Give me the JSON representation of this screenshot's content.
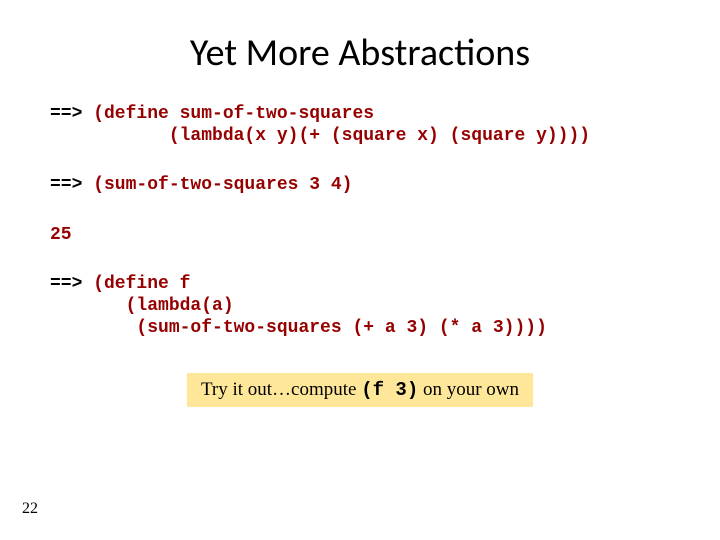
{
  "title": "Yet More Abstractions",
  "prompt": "==>",
  "code1a": " (define sum-of-two-squares",
  "code1b": "           (lambda(x y)(+ (square x) (square y))))",
  "code2": " (sum-of-two-squares 3 4)",
  "result": "25",
  "code3a": " (define f",
  "code3b": "       (lambda(a)",
  "code3c": "        (sum-of-two-squares (+ a 3) (* a 3))))",
  "callout_pre": "Try it out…compute ",
  "callout_code": "(f 3)",
  "callout_post": " on your own",
  "page": "22"
}
